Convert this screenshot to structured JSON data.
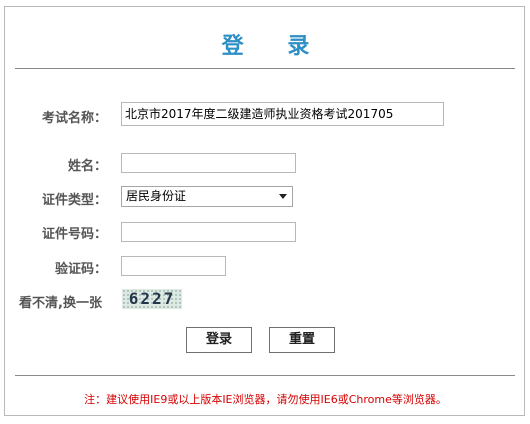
{
  "title": "登 录",
  "form": {
    "exam_name_label": "考试名称：",
    "exam_name_value": "北京市2017年度二级建造师执业资格考试201705",
    "name_label": "姓名：",
    "name_value": "",
    "id_type_label": "证件类型：",
    "id_type_selected": "居民身份证",
    "id_number_label": "证件号码：",
    "id_number_value": "",
    "captcha_label": "验证码：",
    "captcha_value": "",
    "refresh_captcha_label": "看不清,换一张",
    "captcha_code": "6227"
  },
  "buttons": {
    "login": "登录",
    "reset": "重置"
  },
  "note": "注：建议使用IE9或以上版本IE浏览器，请勿使用IE6或Chrome等浏览器。",
  "colors": {
    "title": "#2e8fc7",
    "note": "#d60000",
    "label": "#555555"
  }
}
